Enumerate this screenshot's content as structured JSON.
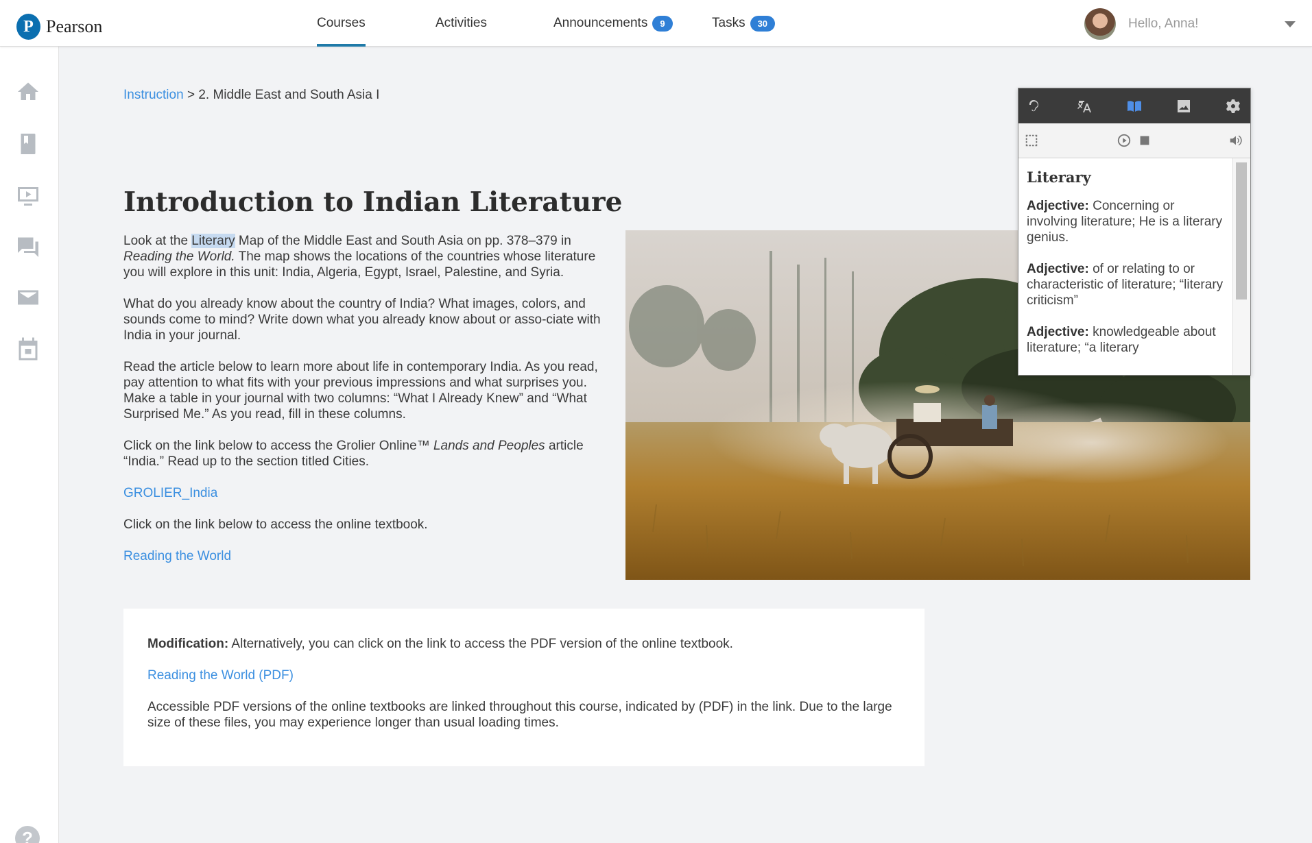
{
  "brand": {
    "logo_letter": "P",
    "name": "Pearson"
  },
  "nav": {
    "items": [
      {
        "label": "Courses"
      },
      {
        "label": "Activities"
      },
      {
        "label": "Announcements",
        "badge": "9"
      },
      {
        "label": "Tasks",
        "badge": "30"
      }
    ],
    "active": "Courses",
    "greeting": "Hello, Anna!"
  },
  "sidebar": {
    "icons": [
      "home-icon",
      "book-icon",
      "video-icon",
      "chat-icon",
      "mail-icon",
      "calendar-icon"
    ],
    "help_label": "?"
  },
  "breadcrumb": {
    "link": "Instruction",
    "separator": ">",
    "current": "2. Middle East and South Asia I"
  },
  "page": {
    "title": "Introduction to Indian Literature",
    "p1_before": "Look at the ",
    "p1_highlight": "Literary",
    "p1_after": " Map of the Middle East and South Asia on pp. 378–379 in ",
    "p1_italic": "Reading the World.",
    "p1_end": " The map shows the locations of the countries whose literature you will explore in this unit: India, Algeria, Egypt, Israel, Palestine, and Syria.",
    "p2": "What do you already know about the country of India? What images, colors, and sounds come to mind? Write down what you already know about or asso-ciate with India in your journal.",
    "p3": "Read the article below to learn more about life in contemporary India. As you read, pay attention to what fits with your previous impressions and what surprises you. Make a table in your journal with two columns: “What I Already Knew” and “What Surprised Me.” As you read, fill in these columns.",
    "p4_before": "Click on the link below to access the Grolier Online™ ",
    "p4_italic": "Lands and Peoples",
    "p4_after": " article “India.” Read up to the section titled Cities.",
    "link1": "GROLIER_India",
    "p5": "Click on the link below to access the online textbook.",
    "link2": "Reading the World"
  },
  "modification": {
    "label": "Modification:",
    "text": " Alternatively, you can click on the link to access the PDF version of the online textbook.",
    "link": "Reading the World (PDF)",
    "note": "Accessible PDF versions of the online textbooks are linked throughout this course, indicated by (PDF) in the link. Due to the large size of these files, you may experience longer than usual loading times."
  },
  "reader_tool": {
    "toolbar_icons": [
      "listen-icon",
      "translate-icon",
      "dictionary-icon",
      "picture-icon",
      "settings-icon"
    ],
    "active_tool": "dictionary-icon",
    "controls": [
      "select-area-icon",
      "play-icon",
      "stop-icon",
      "volume-icon"
    ],
    "word": "Literary",
    "definitions": [
      {
        "pos": "Adjective:",
        "text": " Concerning or involving literature; He is a literary genius."
      },
      {
        "pos": "Adjective:",
        "text": " of or relating to or characteristic of literature; “literary criticism”"
      },
      {
        "pos": "Adjective:",
        "text": " knowledgeable about literature; “a literary"
      }
    ]
  },
  "colors": {
    "accent": "#1f7aa8",
    "link": "#3b8fe0",
    "badge": "#2f7fd6",
    "highlight": "#c6daf0"
  }
}
